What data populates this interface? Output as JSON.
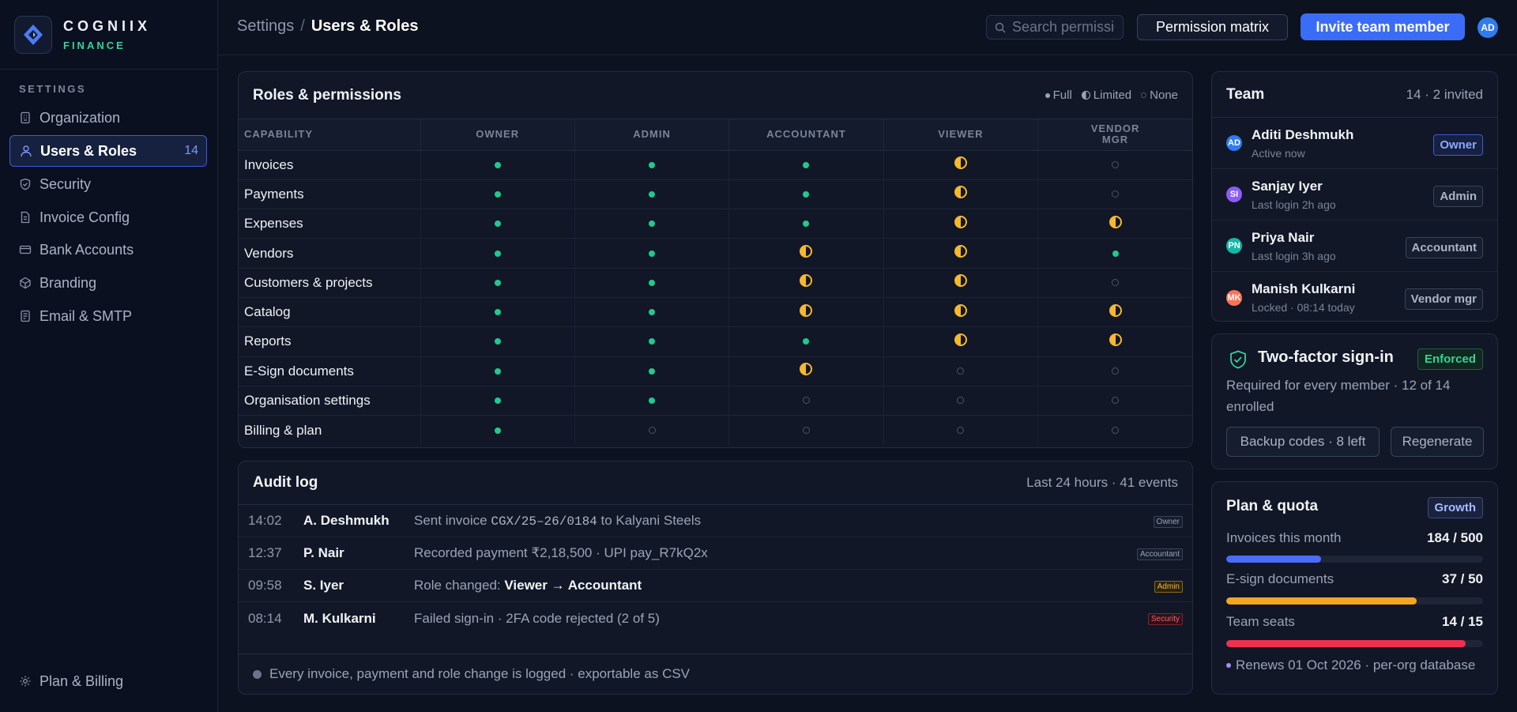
{
  "brand": {
    "name": "COGNIIX",
    "sub": "FINANCE"
  },
  "sidebar": {
    "section_label": "SETTINGS",
    "items": [
      {
        "label": "Organization",
        "icon": "building-icon"
      },
      {
        "label": "Users & Roles",
        "icon": "users-icon",
        "count": "14",
        "active": true
      },
      {
        "label": "Security",
        "icon": "shield-icon"
      },
      {
        "label": "Invoice Config",
        "icon": "file-icon"
      },
      {
        "label": "Bank Accounts",
        "icon": "card-icon"
      },
      {
        "label": "Branding",
        "icon": "palette-icon"
      },
      {
        "label": "Email & SMTP",
        "icon": "mail-icon"
      }
    ],
    "bottom": {
      "label": "Plan & Billing",
      "icon": "gear-icon"
    }
  },
  "topbar": {
    "breadcrumb": {
      "parent": "Settings",
      "separator": "/",
      "current": "Users & Roles"
    },
    "search_placeholder": "Search permissions",
    "permission_matrix_label": "Permission matrix",
    "invite_label": "Invite team member",
    "avatar_initials": "AD"
  },
  "roles": {
    "title": "Roles & permissions",
    "legend": {
      "full": "Full",
      "limited": "Limited",
      "none": "None"
    },
    "columns": [
      "CAPABILITY",
      "OWNER",
      "ADMIN",
      "ACCOUNTANT",
      "VIEWER",
      "VENDOR MGR"
    ],
    "rows": [
      {
        "capability": "Invoices",
        "levels": [
          "full",
          "full",
          "full",
          "limited",
          "none"
        ]
      },
      {
        "capability": "Payments",
        "levels": [
          "full",
          "full",
          "full",
          "limited",
          "none"
        ]
      },
      {
        "capability": "Expenses",
        "levels": [
          "full",
          "full",
          "full",
          "limited",
          "limited"
        ]
      },
      {
        "capability": "Vendors",
        "levels": [
          "full",
          "full",
          "limited",
          "limited",
          "full"
        ]
      },
      {
        "capability": "Customers & projects",
        "levels": [
          "full",
          "full",
          "limited",
          "limited",
          "none"
        ]
      },
      {
        "capability": "Catalog",
        "levels": [
          "full",
          "full",
          "limited",
          "limited",
          "limited"
        ]
      },
      {
        "capability": "Reports",
        "levels": [
          "full",
          "full",
          "full",
          "limited",
          "limited"
        ]
      },
      {
        "capability": "E-Sign documents",
        "levels": [
          "full",
          "full",
          "limited",
          "none",
          "none"
        ]
      },
      {
        "capability": "Organisation settings",
        "levels": [
          "full",
          "full",
          "none",
          "none",
          "none"
        ]
      },
      {
        "capability": "Billing & plan",
        "levels": [
          "full",
          "none",
          "none",
          "none",
          "none"
        ]
      }
    ]
  },
  "audit": {
    "title": "Audit log",
    "meta": "Last 24 hours · 41 events",
    "entries": [
      {
        "time": "14:02",
        "who": "A. Deshmukh",
        "pre": "Sent invoice ",
        "code": "CGX/25–26/0184",
        "post": " to Kalyani Steels",
        "tag": "Owner"
      },
      {
        "time": "12:37",
        "who": "P. Nair",
        "pre": "Recorded payment ₹2,18,500 · UPI pay_R7kQ2x",
        "tag": "Accountant"
      },
      {
        "time": "09:58",
        "who": "S. Iyer",
        "pre": "Role changed: ",
        "bold": "Viewer → Accountant",
        "tag": "Admin"
      },
      {
        "time": "08:14",
        "who": "M. Kulkarni",
        "pre": "Failed sign-in · 2FA code rejected (2 of 5)",
        "tag": "Security"
      }
    ],
    "footer": "Every invoice, payment and role change is logged · exportable as CSV"
  },
  "team": {
    "title": "Team",
    "meta": "14 · 2 invited",
    "members": [
      {
        "initials": "AD",
        "name": "Aditi Deshmukh",
        "status": "Active now",
        "role": "Owner",
        "color": "#2f7bf0"
      },
      {
        "initials": "SI",
        "name": "Sanjay Iyer",
        "status": "Last login 2h ago",
        "role": "Admin",
        "color": "#8b5cf6"
      },
      {
        "initials": "PN",
        "name": "Priya Nair",
        "status": "Last login 3h ago",
        "role": "Accountant",
        "color": "#14b8a6"
      },
      {
        "initials": "MK",
        "name": "Manish Kulkarni",
        "status": "Locked · 08:14 today",
        "role": "Vendor mgr",
        "color": "#f97355"
      }
    ]
  },
  "tfa": {
    "title": "Two-factor sign-in",
    "badge": "Enforced",
    "desc": "Required for every member · 12 of 14 enrolled",
    "backup_label": "Backup codes · 8 left",
    "regen_label": "Regenerate"
  },
  "plan": {
    "title": "Plan & quota",
    "badge": "Growth",
    "quotas": [
      {
        "label": "Invoices this month",
        "value": "184 / 500",
        "fraction": 0.368,
        "color": "#4a6cf7"
      },
      {
        "label": "E-sign documents",
        "value": "37 / 50",
        "fraction": 0.74,
        "color": "#f5a524"
      },
      {
        "label": "Team seats",
        "value": "14 / 15",
        "fraction": 0.933,
        "color": "#f0304e"
      }
    ],
    "renew": "Renews 01 Oct 2026 · per-org database"
  }
}
